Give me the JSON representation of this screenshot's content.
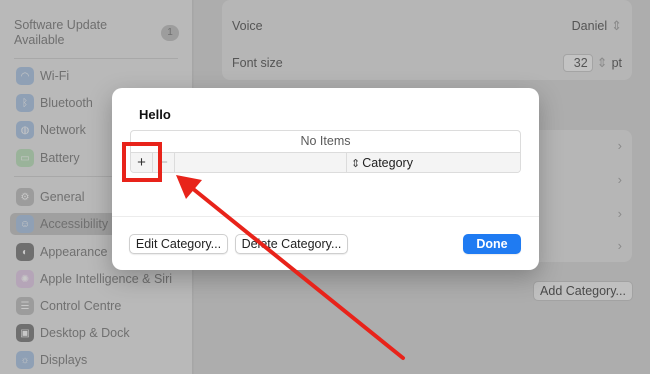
{
  "sidebar": {
    "update": {
      "label": "Software Update Available",
      "badge": "1"
    },
    "items": [
      {
        "label": "Wi-Fi",
        "icon": "wifi-icon",
        "color": "#8fa0b5"
      },
      {
        "label": "Bluetooth",
        "icon": "bluetooth-icon",
        "color": "#8fa0b5"
      },
      {
        "label": "Network",
        "icon": "network-icon",
        "color": "#8fa0b5"
      },
      {
        "label": "Battery",
        "icon": "battery-icon",
        "color": "#9ab39a"
      },
      {
        "label": "General",
        "icon": "gear-icon",
        "color": "#9c9c9c"
      },
      {
        "label": "Accessibility",
        "icon": "accessibility-icon",
        "color": "#8fa0b5",
        "selected": true
      },
      {
        "label": "Appearance",
        "icon": "appearance-icon",
        "color": "#6f6f6f"
      },
      {
        "label": "Apple Intelligence & Siri",
        "icon": "siri-icon",
        "color": "#b5a5b8"
      },
      {
        "label": "Control Centre",
        "icon": "control-centre-icon",
        "color": "#9c9c9c"
      },
      {
        "label": "Desktop & Dock",
        "icon": "dock-icon",
        "color": "#6f6f6f"
      },
      {
        "label": "Displays",
        "icon": "display-icon",
        "color": "#8fa0b5"
      }
    ]
  },
  "main": {
    "voice_label": "Voice",
    "voice_value": "Daniel",
    "font_size_label": "Font size",
    "font_size_value": "32",
    "font_size_unit": "pt",
    "add_category_label": "Add Category..."
  },
  "dialog": {
    "title": "Hello",
    "table_empty": "No Items",
    "plus": "+",
    "minus": "−",
    "column_header": "Category",
    "edit_label": "Edit Category...",
    "delete_label": "Delete Category...",
    "done_label": "Done"
  },
  "colors": {
    "accent": "#1f7bf2",
    "annotation": "#e8231a"
  }
}
